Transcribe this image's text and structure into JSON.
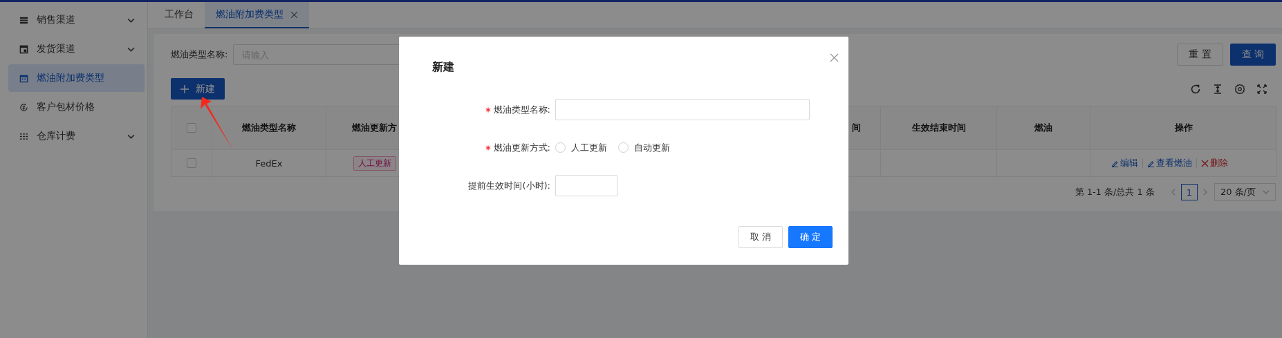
{
  "sidebar": {
    "items": [
      {
        "label": "销售渠道",
        "selected": false,
        "has_submenu": true
      },
      {
        "label": "发货渠道",
        "selected": false,
        "has_submenu": true
      },
      {
        "label": "燃油附加费类型",
        "selected": true,
        "has_submenu": false
      },
      {
        "label": "客户包材价格",
        "selected": false,
        "has_submenu": false
      },
      {
        "label": "仓库计费",
        "selected": false,
        "has_submenu": true
      }
    ]
  },
  "tabs": [
    {
      "label": "工作台",
      "selected": false,
      "closable": false
    },
    {
      "label": "燃油附加费类型",
      "selected": true,
      "closable": true
    }
  ],
  "filter": {
    "label": "燃油类型名称:",
    "placeholder": "请输入",
    "buttons": [
      {
        "label": "重 置",
        "kind": "default"
      },
      {
        "label": "查 询",
        "kind": "primary"
      }
    ]
  },
  "new_button": "新建",
  "table": {
    "header_checked": false,
    "columns": [
      "燃油类型名称",
      "燃油更新方",
      "间",
      "生效结束时间",
      "燃油",
      "操作"
    ],
    "rows": [
      {
        "checked": false,
        "cells": [
          {
            "kind": "text",
            "text": "FedEx"
          },
          {
            "kind": "tag",
            "text": "人工更新"
          },
          {
            "kind": "empty"
          },
          {
            "kind": "empty"
          },
          {
            "kind": "empty"
          }
        ],
        "actions": [
          {
            "label": "编辑",
            "kind": "edit"
          },
          {
            "label": "查看燃油",
            "kind": "view"
          },
          {
            "label": "删除",
            "kind": "delete"
          }
        ]
      }
    ]
  },
  "pagination": {
    "summary": "第 1-1 条/总共 1 条",
    "pages": [
      {
        "label": "1",
        "selected": true
      }
    ],
    "page_size": "20 条/页"
  },
  "modal": {
    "title": "新建",
    "fields": [
      {
        "kind": "text",
        "label": "燃油类型名称:",
        "required": true
      },
      {
        "kind": "radio",
        "label": "燃油更新方式:",
        "required": true,
        "options": [
          {
            "label": "人工更新",
            "selected": false
          },
          {
            "label": "自动更新",
            "selected": false
          }
        ]
      },
      {
        "kind": "short",
        "label": "提前生效时间(小时):",
        "required": false
      }
    ],
    "buttons": [
      {
        "label": "取 消",
        "kind": "default"
      },
      {
        "label": "确 定",
        "kind": "primary"
      }
    ]
  }
}
